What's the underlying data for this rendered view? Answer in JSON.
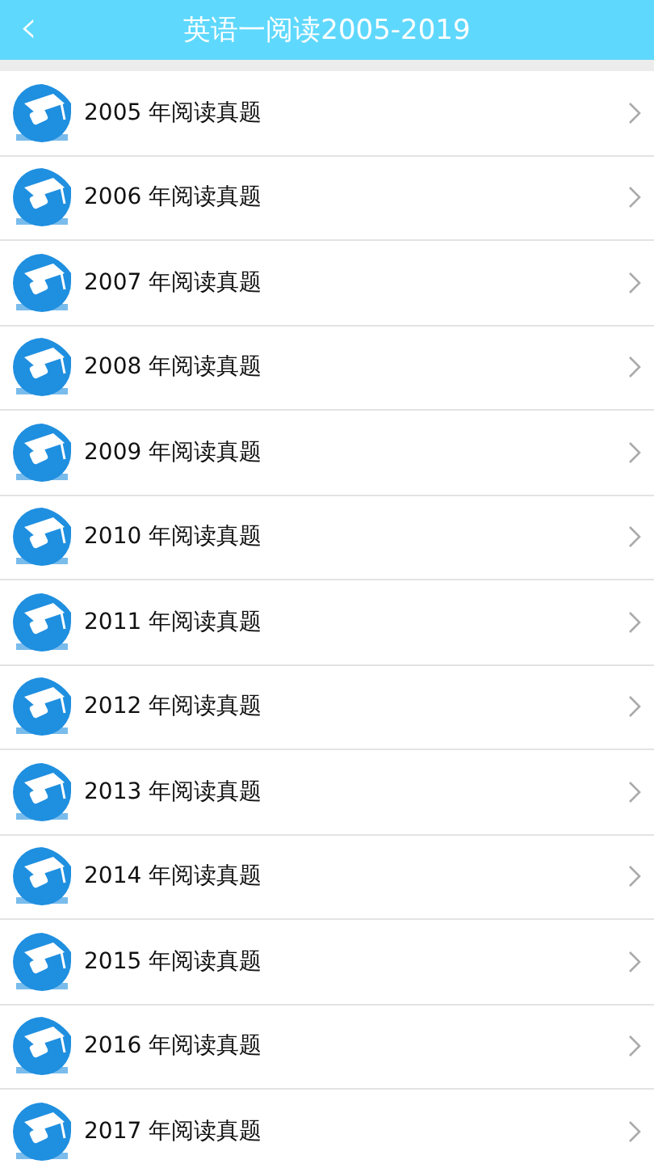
{
  "header": {
    "back": "‹",
    "title": "英语一阅读2005-2019"
  },
  "items": [
    {
      "label": "2005 年阅读真题"
    },
    {
      "label": "2006 年阅读真题"
    },
    {
      "label": "2007 年阅读真题"
    },
    {
      "label": "2008 年阅读真题"
    },
    {
      "label": "2009 年阅读真题"
    },
    {
      "label": "2010 年阅读真题"
    },
    {
      "label": "2011 年阅读真题"
    },
    {
      "label": "2012 年阅读真题"
    },
    {
      "label": "2013 年阅读真题"
    },
    {
      "label": "2014 年阅读真题"
    },
    {
      "label": "2015 年阅读真题"
    },
    {
      "label": "2016 年阅读真题"
    },
    {
      "label": "2017 年阅读真题"
    }
  ]
}
